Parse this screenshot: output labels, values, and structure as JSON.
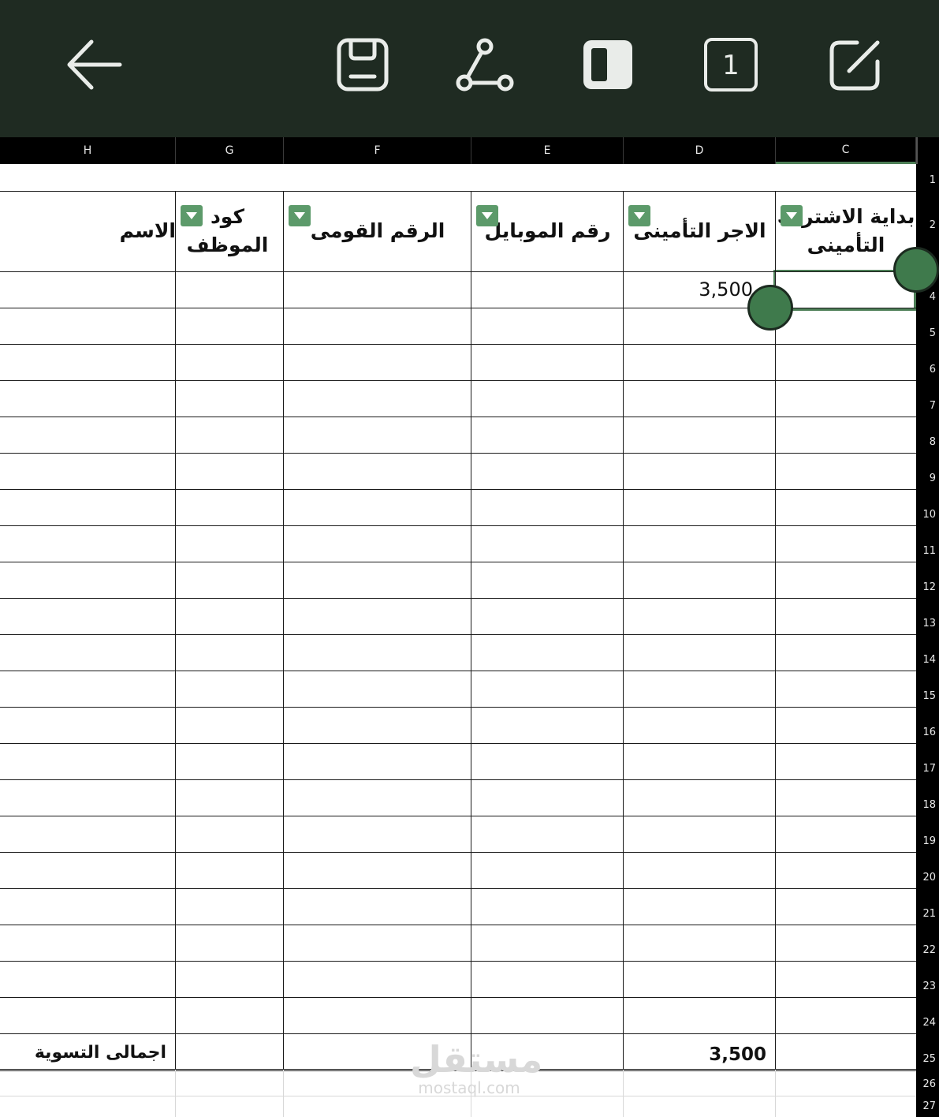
{
  "toolbar": {
    "back_icon": "arrow-left-icon",
    "save_icon": "save-icon",
    "share_icon": "share-icon",
    "layout_icon": "split-view-icon",
    "page_count": "1",
    "edit_icon": "edit-icon",
    "background": "#1f2b22"
  },
  "columns": [
    "H",
    "G",
    "F",
    "E",
    "D",
    "C"
  ],
  "rows": [
    "1",
    "2",
    "3",
    "4",
    "5",
    "6",
    "7",
    "8",
    "9",
    "10",
    "11",
    "12",
    "13",
    "14",
    "15",
    "16",
    "17",
    "18",
    "19",
    "20",
    "21",
    "22",
    "23",
    "24",
    "25",
    "26",
    "27"
  ],
  "headers": {
    "H": "الاسم",
    "G": "كود الموظف",
    "F": "الرقم القومى",
    "E": "رقم الموبايل",
    "D": "الاجر التأمينى",
    "C_line1": "بداية الاشتراك",
    "C_line2": "التأمينى"
  },
  "cells": {
    "D4": "3,500",
    "H25": "اجمالى التسوية",
    "D25": "3,500"
  },
  "selected_cell": "C4",
  "accent_color": "#4d7f57",
  "watermark": {
    "logo": "مستقل",
    "url": "mostaql.com"
  }
}
